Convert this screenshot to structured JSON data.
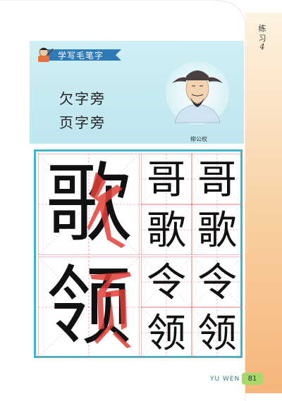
{
  "side": {
    "label": "练习",
    "number": "4"
  },
  "banner": {
    "title": "学写毛笔字"
  },
  "topics": [
    "欠字旁",
    "页字旁"
  ],
  "portrait": {
    "caption": "柳公权"
  },
  "practice": {
    "rows": [
      {
        "big": "歌",
        "samples": [
          "哥",
          "哥",
          "歌",
          "歌"
        ]
      },
      {
        "big": "领",
        "samples": [
          "令",
          "令",
          "领",
          "领"
        ]
      }
    ]
  },
  "footer": {
    "label": "YU WEN",
    "page": "81"
  },
  "colors": {
    "grid_border": "#3cb8c8",
    "guide_red": "#e27a7a",
    "highlight": "#e0403a",
    "badge": "#a8d86a"
  }
}
